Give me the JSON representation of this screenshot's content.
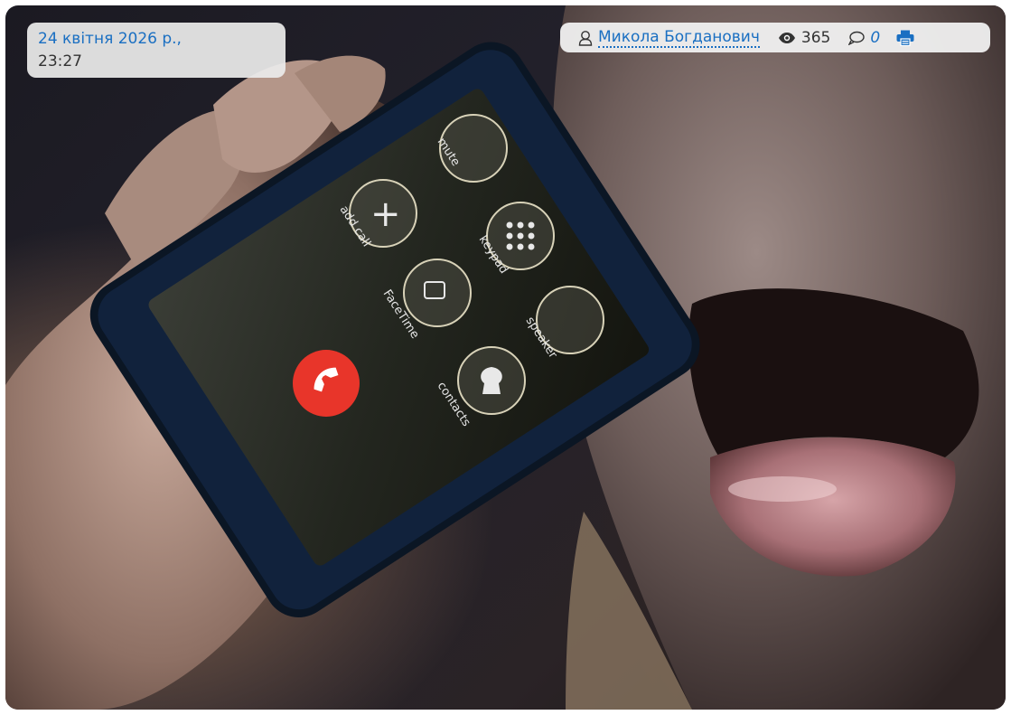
{
  "article": {
    "date_label": "24 квітня 2026 р.,",
    "time_label": "23:27",
    "author": "Микола Богданович",
    "views": "365",
    "comments": "0"
  },
  "photo": {
    "phone_labels": {
      "mute": "mute",
      "add_call": "add call",
      "keypad": "keypad",
      "facetime": "FaceTime",
      "speaker": "speaker",
      "contacts": "contacts"
    }
  },
  "icons": {
    "author": "user-icon",
    "views": "eye-icon",
    "comments": "comment-icon",
    "print": "print-icon"
  },
  "colors": {
    "link": "#1a6fc2",
    "end_call": "#e8352a",
    "print": "#1a6fc2"
  }
}
